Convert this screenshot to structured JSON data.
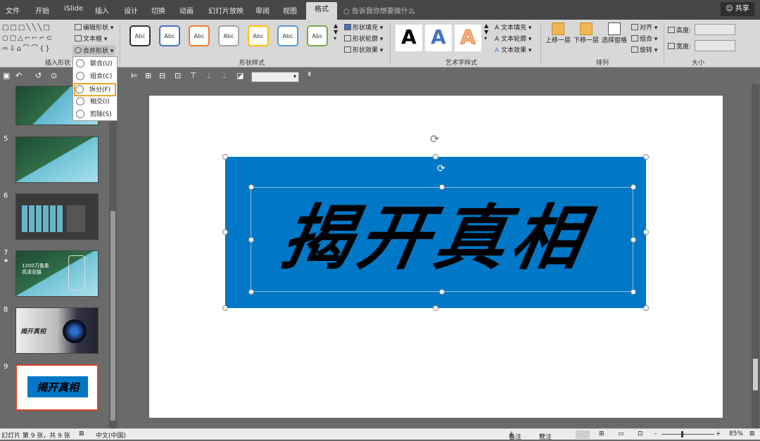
{
  "tabs": [
    "文件",
    "开始",
    "iSlide",
    "插入",
    "设计",
    "切换",
    "动画",
    "幻灯片放映",
    "审阅",
    "视图",
    "格式"
  ],
  "active_tab": "格式",
  "tell_me": "告诉我你想要做什么",
  "share": "共享",
  "ribbon": {
    "insert_shapes": {
      "label": "插入形状",
      "edit_shape": "编辑形状",
      "text_box": "文本框",
      "merge_shapes": "合并形状"
    },
    "shape_styles": {
      "label": "形状样式",
      "preview": [
        "Abc",
        "Abc",
        "Abc",
        "Abc",
        "Abc",
        "Abc",
        "Abc"
      ],
      "fill": "形状填充",
      "outline": "形状轮廓",
      "effects": "形状效果"
    },
    "wordart_styles": {
      "label": "艺术字样式",
      "samples": [
        "A",
        "A",
        "A"
      ],
      "text_fill": "文本填充",
      "text_outline": "文本轮廓",
      "text_effects": "文本效果"
    },
    "arrange": {
      "label": "排列",
      "bring_forward": "上移一层",
      "send_backward": "下移一层",
      "selection_pane": "选择窗格",
      "align": "对齐",
      "group": "组合",
      "rotate": "旋转"
    },
    "size": {
      "label": "大小",
      "height": "高度:",
      "width": "宽度:"
    }
  },
  "merge_menu": [
    "联合(U)",
    "组合(C)",
    "拆分(F)",
    "相交(I)",
    "剪除(S)"
  ],
  "slides": [
    {
      "number": "5"
    },
    {
      "number": "6"
    },
    {
      "number": "7",
      "star": "★",
      "title_line1": "1200万像素",
      "title_line2": "高清双摄"
    },
    {
      "number": "8",
      "text": "揭开真相"
    },
    {
      "number": "9",
      "text": "揭开真相"
    }
  ],
  "slide_text": "揭开真相",
  "status": {
    "slide": "幻灯片 第 9 张，共 9 张",
    "language": "中文(中国)",
    "notes": "备注",
    "comments": "批注",
    "zoom": "85%",
    "zoom_minus": "-",
    "zoom_plus": "+"
  },
  "colors": {
    "blue_shape": "#0077c7",
    "menu_highlight": "#f0a62c",
    "selected_thumb": "#d24726"
  }
}
